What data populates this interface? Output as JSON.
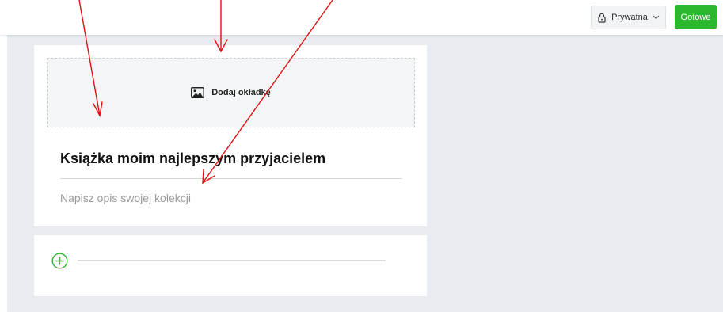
{
  "topbar": {
    "privacy": {
      "label": "Prywatna",
      "icon": "lock-icon",
      "dropdown_icon": "chevron-down-icon"
    },
    "done_label": "Gotowe"
  },
  "collection": {
    "cover": {
      "label": "Dodaj okładkę",
      "icon": "image-icon"
    },
    "title": "Książka moim najlepszym przyjacielem",
    "description_placeholder": "Napisz opis swojej kolekcji"
  },
  "add_section": {
    "icon": "plus-circle-icon"
  },
  "colors": {
    "accent_green": "#2cb82c",
    "workspace_bg": "#e8ebef",
    "annotation_red": "#e01010"
  }
}
